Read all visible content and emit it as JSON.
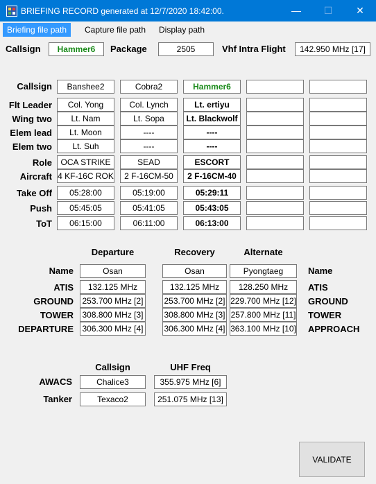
{
  "window": {
    "title": "BRIEFING RECORD generated at 12/7/2020 18:42:00.",
    "min_glyph": "—",
    "max_glyph": "☐",
    "close_glyph": "✕"
  },
  "tabs": [
    {
      "label": "Briefing file path"
    },
    {
      "label": "Capture file path"
    },
    {
      "label": "Display path"
    }
  ],
  "top": {
    "callsign_label": "Callsign",
    "callsign_value": "Hammer6",
    "package_label": "Package",
    "package_value": "2505",
    "vhf_label": "Vhf Intra Flight",
    "vhf_value": "142.950 MHz [17]"
  },
  "flights": {
    "row_labels": {
      "callsign": "Callsign",
      "flt_leader": "Flt Leader",
      "wing_two": "Wing two",
      "elem_lead": "Elem lead",
      "elem_two": "Elem two",
      "role": "Role",
      "aircraft": "Aircraft",
      "take_off": "Take Off",
      "push": "Push",
      "tot": "ToT"
    },
    "columns": [
      {
        "callsign": "Banshee2",
        "flt_leader": "Col. Yong",
        "wing_two": "Lt. Nam",
        "elem_lead": "Lt. Moon",
        "elem_two": "Lt. Suh",
        "role": "OCA STRIKE",
        "aircraft": "4 KF-16C ROK",
        "take_off": "05:28:00",
        "push": "05:45:05",
        "tot": "06:15:00"
      },
      {
        "callsign": "Cobra2",
        "flt_leader": "Col. Lynch",
        "wing_two": "Lt. Sopa",
        "elem_lead": "----",
        "elem_two": "----",
        "role": "SEAD",
        "aircraft": "2 F-16CM-50",
        "take_off": "05:19:00",
        "push": "05:41:05",
        "tot": "06:11:00"
      },
      {
        "callsign": "Hammer6",
        "flt_leader": "Lt. ertiyu",
        "wing_two": "Lt. Blackwolf",
        "elem_lead": "----",
        "elem_two": "----",
        "role": "ESCORT",
        "aircraft": "2 F-16CM-40",
        "take_off": "05:29:11",
        "push": "05:43:05",
        "tot": "06:13:00"
      },
      {
        "callsign": "",
        "flt_leader": "",
        "wing_two": "",
        "elem_lead": "",
        "elem_two": "",
        "role": "",
        "aircraft": "",
        "take_off": "",
        "push": "",
        "tot": ""
      },
      {
        "callsign": "",
        "flt_leader": "",
        "wing_two": "",
        "elem_lead": "",
        "elem_two": "",
        "role": "",
        "aircraft": "",
        "take_off": "",
        "push": "",
        "tot": ""
      }
    ]
  },
  "airfields": {
    "headers": {
      "departure": "Departure",
      "recovery": "Recovery",
      "alternate": "Alternate"
    },
    "left_labels": {
      "name": "Name",
      "atis": "ATIS",
      "ground": "GROUND",
      "tower": "TOWER",
      "departure": "DEPARTURE"
    },
    "right_labels": {
      "name": "Name",
      "atis": "ATIS",
      "ground": "GROUND",
      "tower": "TOWER",
      "approach": "APPROACH"
    },
    "departure": {
      "name": "Osan",
      "atis": "132.125 MHz",
      "ground": "253.700 MHz [2]",
      "tower": "308.800 MHz [3]",
      "departure": "306.300 MHz [4]"
    },
    "recovery": {
      "name": "Osan",
      "atis": "132.125 MHz",
      "ground": "253.700 MHz [2]",
      "tower": "308.800 MHz [3]",
      "departure": "306.300 MHz [4]"
    },
    "alternate": {
      "name": "Pyongtaeg",
      "atis": "128.250 MHz",
      "ground": "229.700 MHz [12]",
      "tower": "257.800 MHz [11]",
      "approach": "363.100 MHz [10]"
    }
  },
  "support": {
    "callsign_header": "Callsign",
    "uhf_header": "UHF Freq",
    "awacs_label": "AWACS",
    "awacs_callsign": "Chalice3",
    "awacs_freq": "355.975 MHz [6]",
    "tanker_label": "Tanker",
    "tanker_callsign": "Texaco2",
    "tanker_freq": "251.075 MHz [13]"
  },
  "validate_label": "VALIDATE",
  "colors": {
    "titlebar": "#0078d7",
    "tab_active": "#3399ff",
    "own_callsign": "#1a8a1a",
    "background": "#f0f0f0"
  }
}
